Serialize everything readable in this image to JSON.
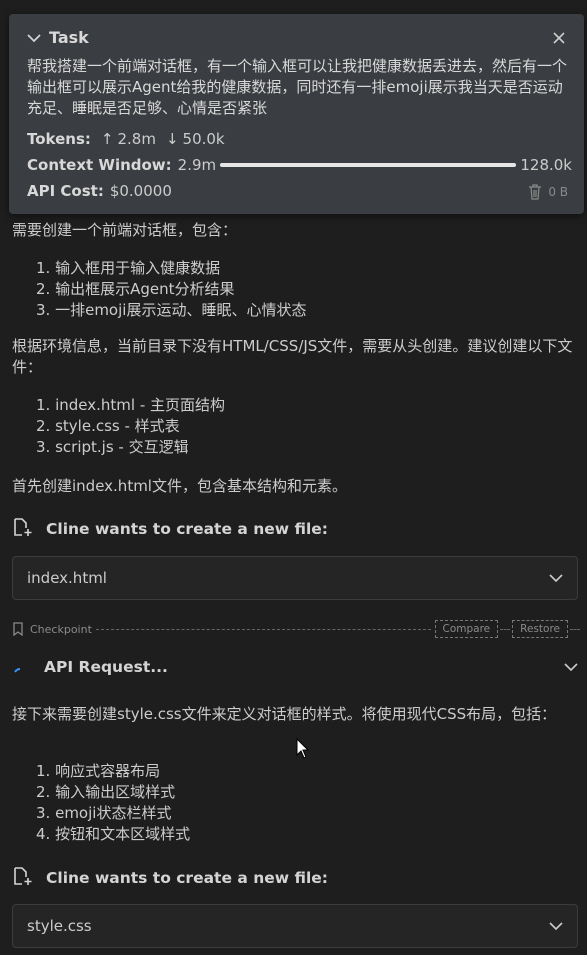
{
  "task": {
    "title": "Task",
    "text": "帮我搭建一个前端对话框，有一个输入框可以让我把健康数据丢进去，然后有一个输出框可以展示Agent给我的健康数据，同时还有一排emoji展示我当天是否运动充足、睡眠是否足够、心情是否紧张",
    "tokens_label": "Tokens:",
    "tokens_up": "2.8m",
    "tokens_down": "50.0k",
    "context_label": "Context Window:",
    "context_used": "2.9m",
    "context_max": "128.0k",
    "context_fill": 1.0,
    "cost_label": "API Cost:",
    "cost_value": "$0.0000",
    "storage": "0 B"
  },
  "chat": {
    "partial_line": "需要创建一个前端对话框，包含：",
    "list1": [
      "输入框用于输入健康数据",
      "输出框展示Agent分析结果",
      "一排emoji展示运动、睡眠、心情状态"
    ],
    "para1": "根据环境信息，当前目录下没有HTML/CSS/JS文件，需要从头创建。建议创建以下文件：",
    "list2": [
      "index.html - 主页面结构",
      "style.css - 样式表",
      "script.js - 交互逻辑"
    ],
    "para2": "首先创建index.html文件，包含基本结构和元素。",
    "file1": {
      "header": "Cline wants to create a new file:",
      "name": "index.html"
    },
    "checkpoint": {
      "label": "Checkpoint",
      "compare": "Compare",
      "restore": "Restore"
    },
    "api_request": "API Request...",
    "para3": "接下来需要创建style.css文件来定义对话框的样式。将使用现代CSS布局，包括：",
    "list3": [
      "响应式容器布局",
      "输入输出区域样式",
      "emoji状态栏样式",
      "按钮和文本区域样式"
    ],
    "file2": {
      "header": "Cline wants to create a new file:",
      "name": "style.css"
    }
  }
}
